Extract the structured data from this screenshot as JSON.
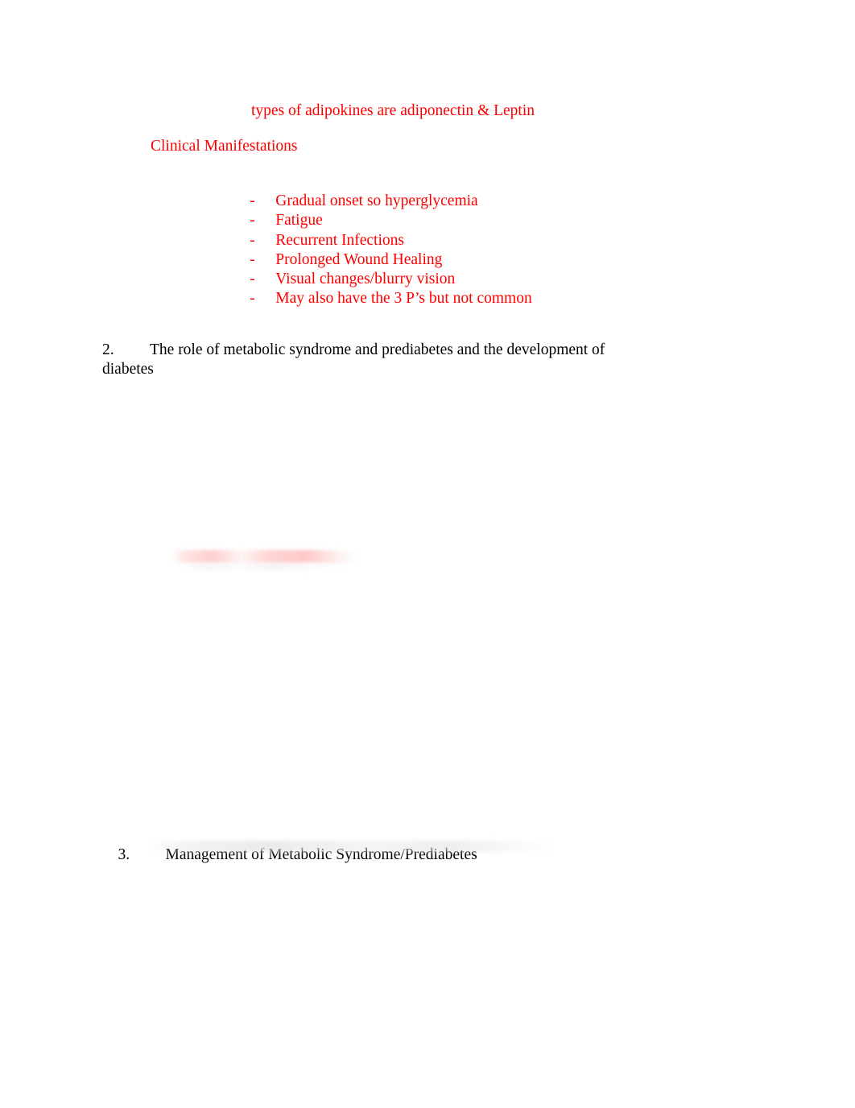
{
  "document": {
    "page_background": "#ffffff",
    "accent_red": "#ff0000",
    "body_black": "#000000",
    "notes_line": "types of adipokines are adiponectin & Leptin",
    "section_heading": "Clinical Manifestations",
    "manifestations": {
      "dash": "-",
      "items": [
        "Gradual onset so hyperglycemia",
        "Fatigue",
        "Recurrent Infections",
        "Prolonged Wound Healing",
        "Visual changes/blurry vision",
        "May also have the 3 P’s but not common"
      ]
    },
    "numbered_items": [
      {
        "number": "2.",
        "text": "The role of metabolic syndrome and prediabetes and the development of diabetes"
      },
      {
        "number": "3.",
        "text": "Management of Metabolic Syndrome/Prediabetes"
      }
    ]
  }
}
